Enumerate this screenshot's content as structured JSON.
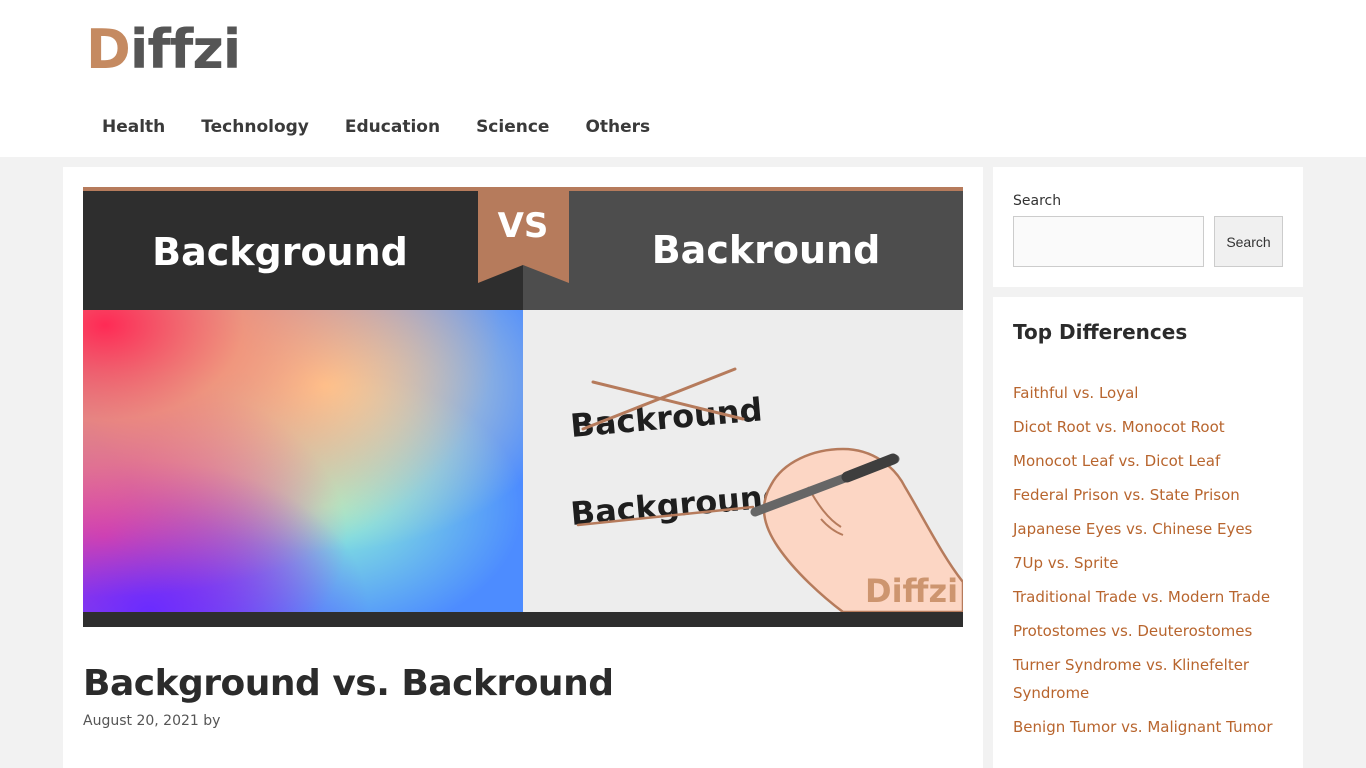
{
  "site": {
    "logo_first": "D",
    "logo_rest": "iffzi",
    "brand_color": "#c58a61",
    "link_color": "#b8652e"
  },
  "nav": {
    "items": [
      "Health",
      "Technology",
      "Education",
      "Science",
      "Others"
    ]
  },
  "hero": {
    "left_word": "Background",
    "vs": "VS",
    "right_word": "Backround",
    "crossed_word": "Backround",
    "correct_word": "Background",
    "watermark": "Diffzi"
  },
  "post": {
    "title": "Background vs. Backround",
    "meta": "August 20, 2021 by"
  },
  "search": {
    "label": "Search",
    "input_value": "",
    "button": "Search"
  },
  "top_differences": {
    "title": "Top Differences",
    "items": [
      "Faithful vs. Loyal",
      "Dicot Root vs. Monocot Root",
      "Monocot Leaf vs. Dicot Leaf",
      "Federal Prison vs. State Prison",
      "Japanese Eyes vs. Chinese Eyes",
      "7Up vs. Sprite",
      "Traditional Trade vs. Modern Trade",
      "Protostomes vs. Deuterostomes",
      "Turner Syndrome vs. Klinefelter Syndrome",
      "Benign Tumor vs. Malignant Tumor"
    ]
  }
}
